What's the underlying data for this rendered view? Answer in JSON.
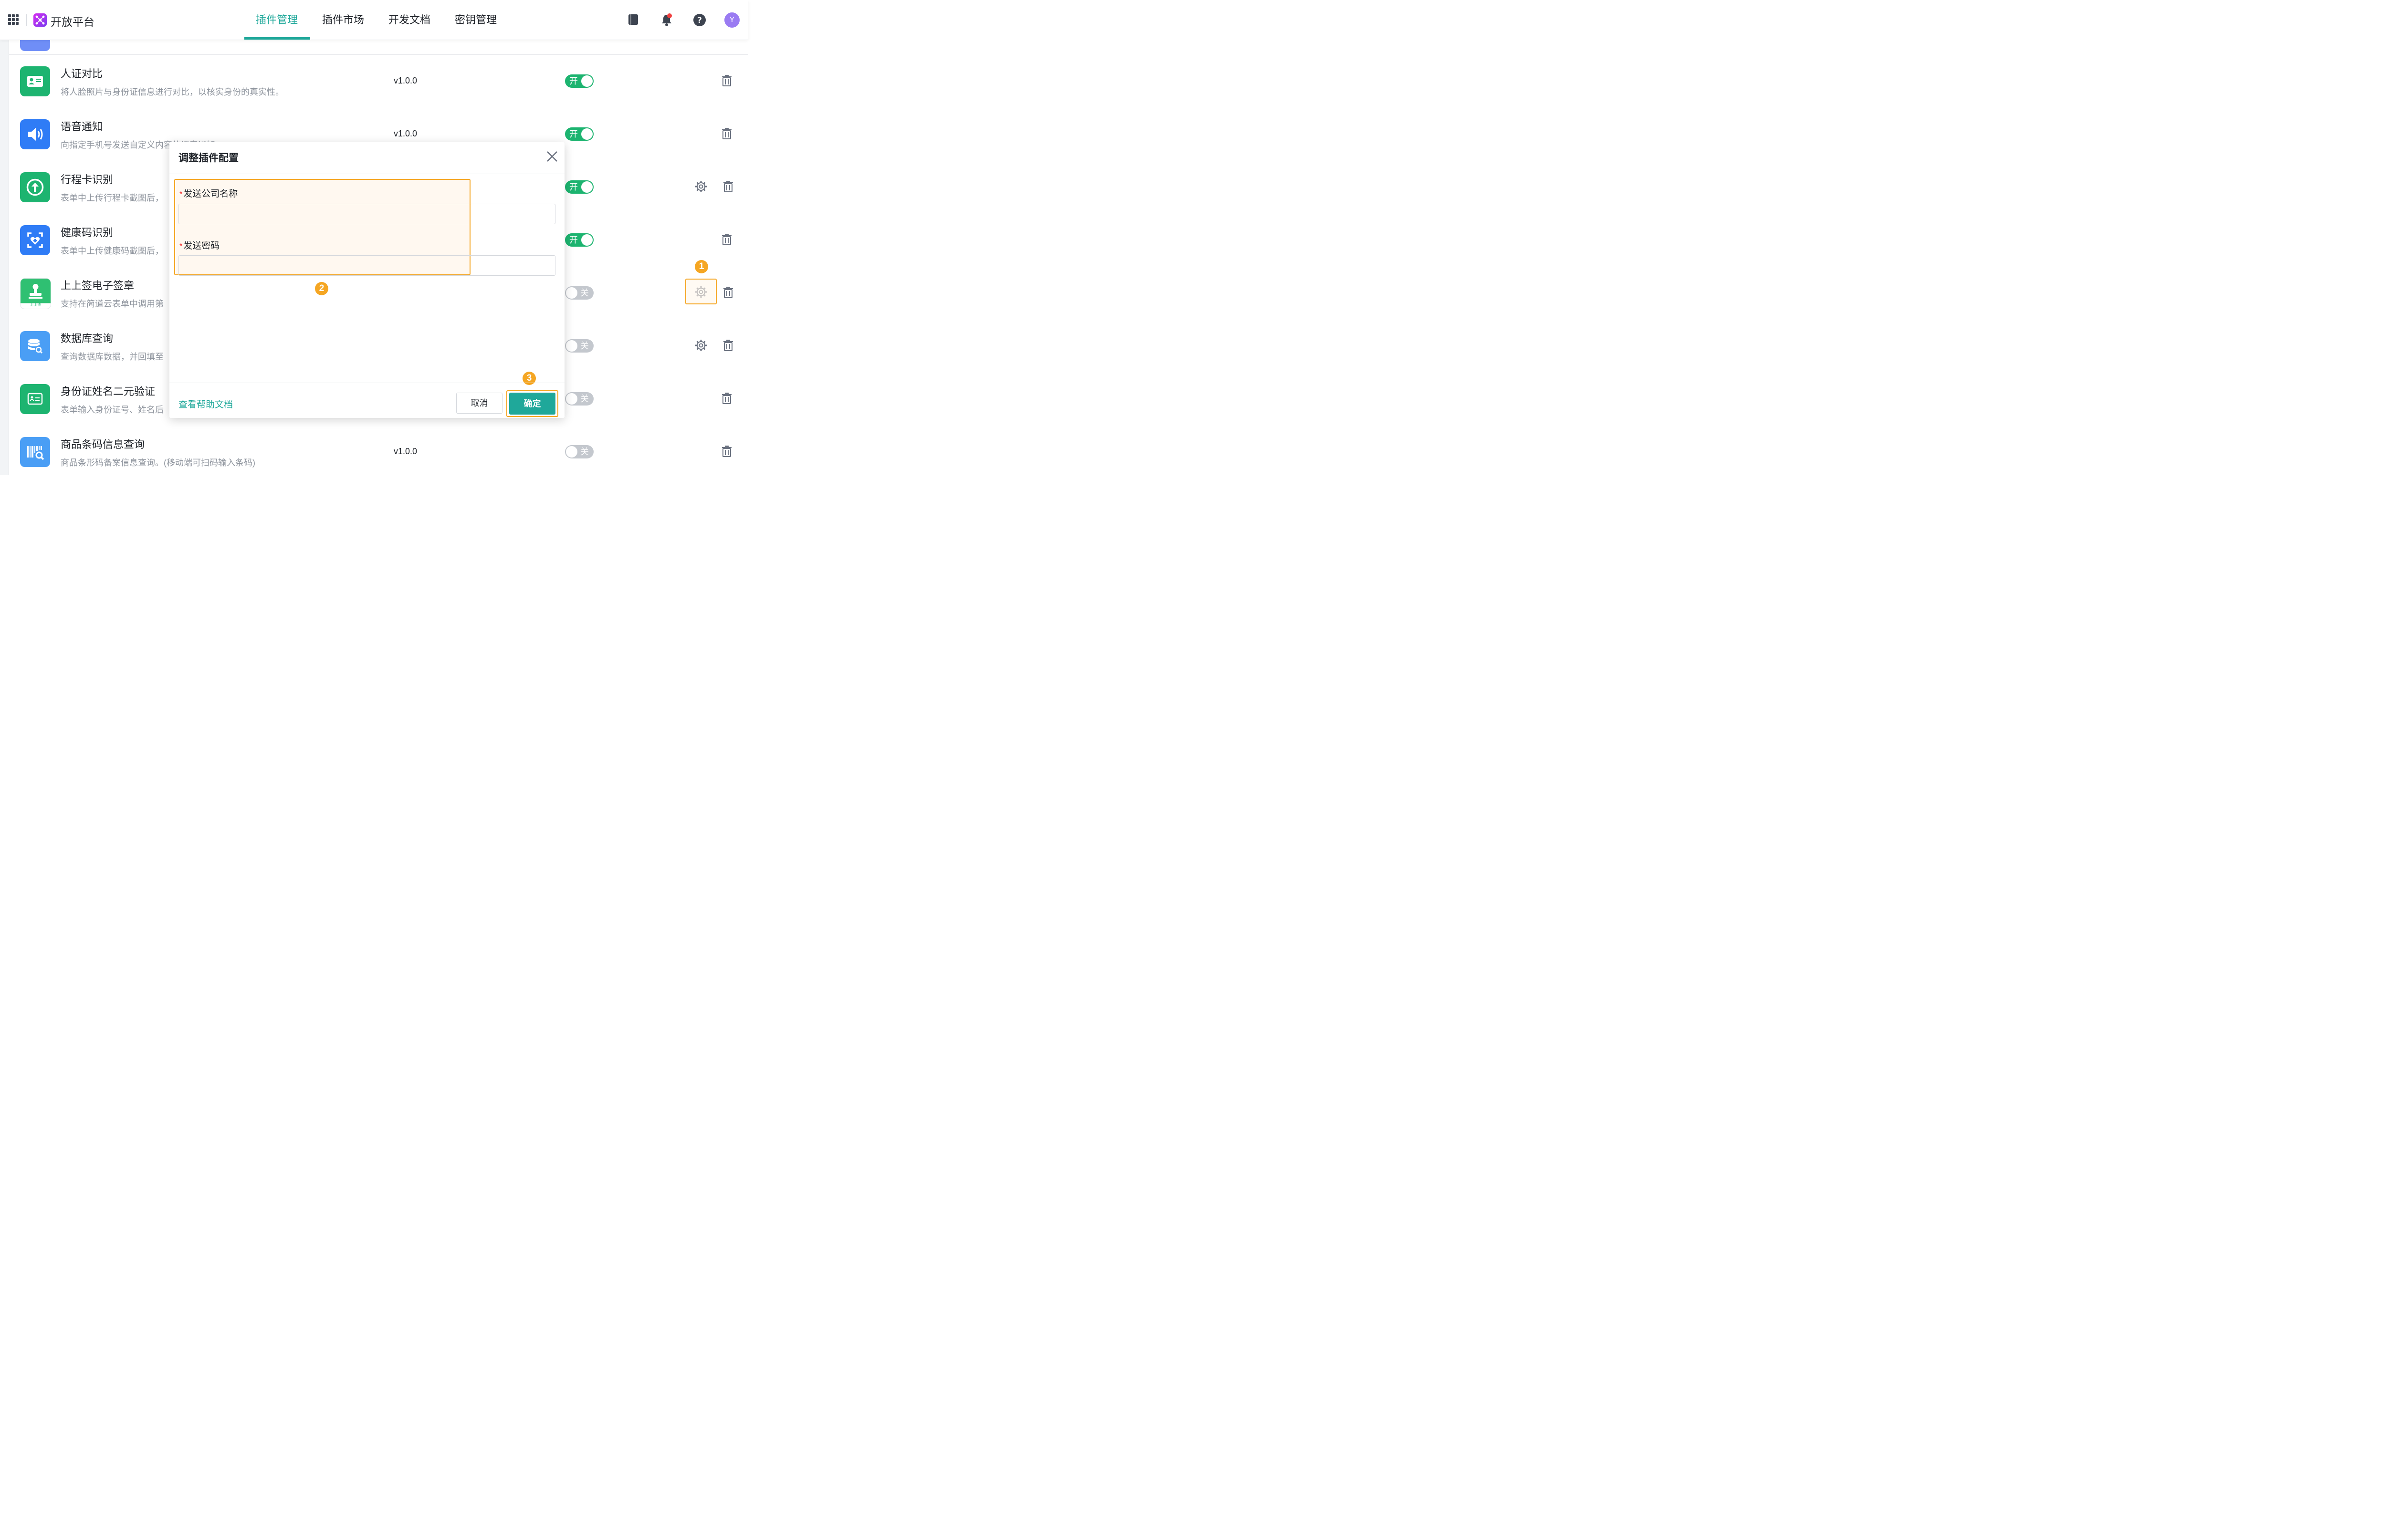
{
  "header": {
    "brand": "开放平台",
    "tabs": [
      {
        "label": "插件管理",
        "active": true
      },
      {
        "label": "插件市场",
        "active": false
      },
      {
        "label": "开发文档",
        "active": false
      },
      {
        "label": "密钥管理",
        "active": false
      }
    ],
    "icons": [
      "apps-grid-icon",
      "notebook-icon",
      "bell-icon",
      "help-icon"
    ],
    "avatar_initial": "Y"
  },
  "plugins": [
    {
      "name": "人证对比",
      "desc": "将人脸照片与身份证信息进行对比，以核实身份的真实性。",
      "version": "v1.0.0",
      "toggle": "开",
      "enabled": true,
      "has_gear": false,
      "icon": "id-card-icon",
      "color": "#1db470"
    },
    {
      "name": "语音通知",
      "desc": "向指定手机号发送自定义内容的语音通知",
      "version": "v1.0.0",
      "toggle": "开",
      "enabled": true,
      "has_gear": false,
      "icon": "speaker-icon",
      "color": "#2f7cf6"
    },
    {
      "name": "行程卡识别",
      "desc": "表单中上传行程卡截图后，",
      "version": "",
      "toggle": "开",
      "enabled": true,
      "has_gear": true,
      "icon": "arrow-up-icon",
      "color": "#1db470"
    },
    {
      "name": "健康码识别",
      "desc": "表单中上传健康码截图后，",
      "version": "",
      "toggle": "开",
      "enabled": true,
      "has_gear": false,
      "icon": "health-code-icon",
      "color": "#2f7cf6"
    },
    {
      "name": "上上签电子签章",
      "desc": "支持在简道云表单中调用第",
      "version": "",
      "toggle": "关",
      "enabled": false,
      "has_gear": true,
      "icon": "stamp-icon",
      "color": "#26b06a",
      "sub_label": "上上签"
    },
    {
      "name": "数据库查询",
      "desc": "查询数据库数据，并回填至",
      "version": "",
      "toggle": "关",
      "enabled": false,
      "has_gear": true,
      "icon": "database-icon",
      "color": "#4a9ef5"
    },
    {
      "name": "身份证姓名二元验证",
      "desc": "表单输入身份证号、姓名后",
      "version": "",
      "toggle": "关",
      "enabled": false,
      "has_gear": false,
      "icon": "id-verify-icon",
      "color": "#1db470"
    },
    {
      "name": "商品条码信息查询",
      "desc": "商品条形码备案信息查询。(移动端可扫码输入条码)",
      "version": "v1.0.0",
      "toggle": "关",
      "enabled": false,
      "has_gear": false,
      "icon": "barcode-icon",
      "color": "#4a9ef5"
    }
  ],
  "annotations": {
    "step1": "1",
    "step2": "2",
    "step3": "3"
  },
  "modal": {
    "title": "调整插件配置",
    "fields": [
      {
        "label": "发送公司名称",
        "required": true,
        "value": ""
      },
      {
        "label": "发送密码",
        "required": true,
        "value": ""
      }
    ],
    "help_link": "查看帮助文档",
    "cancel_label": "取消",
    "confirm_label": "确定"
  }
}
